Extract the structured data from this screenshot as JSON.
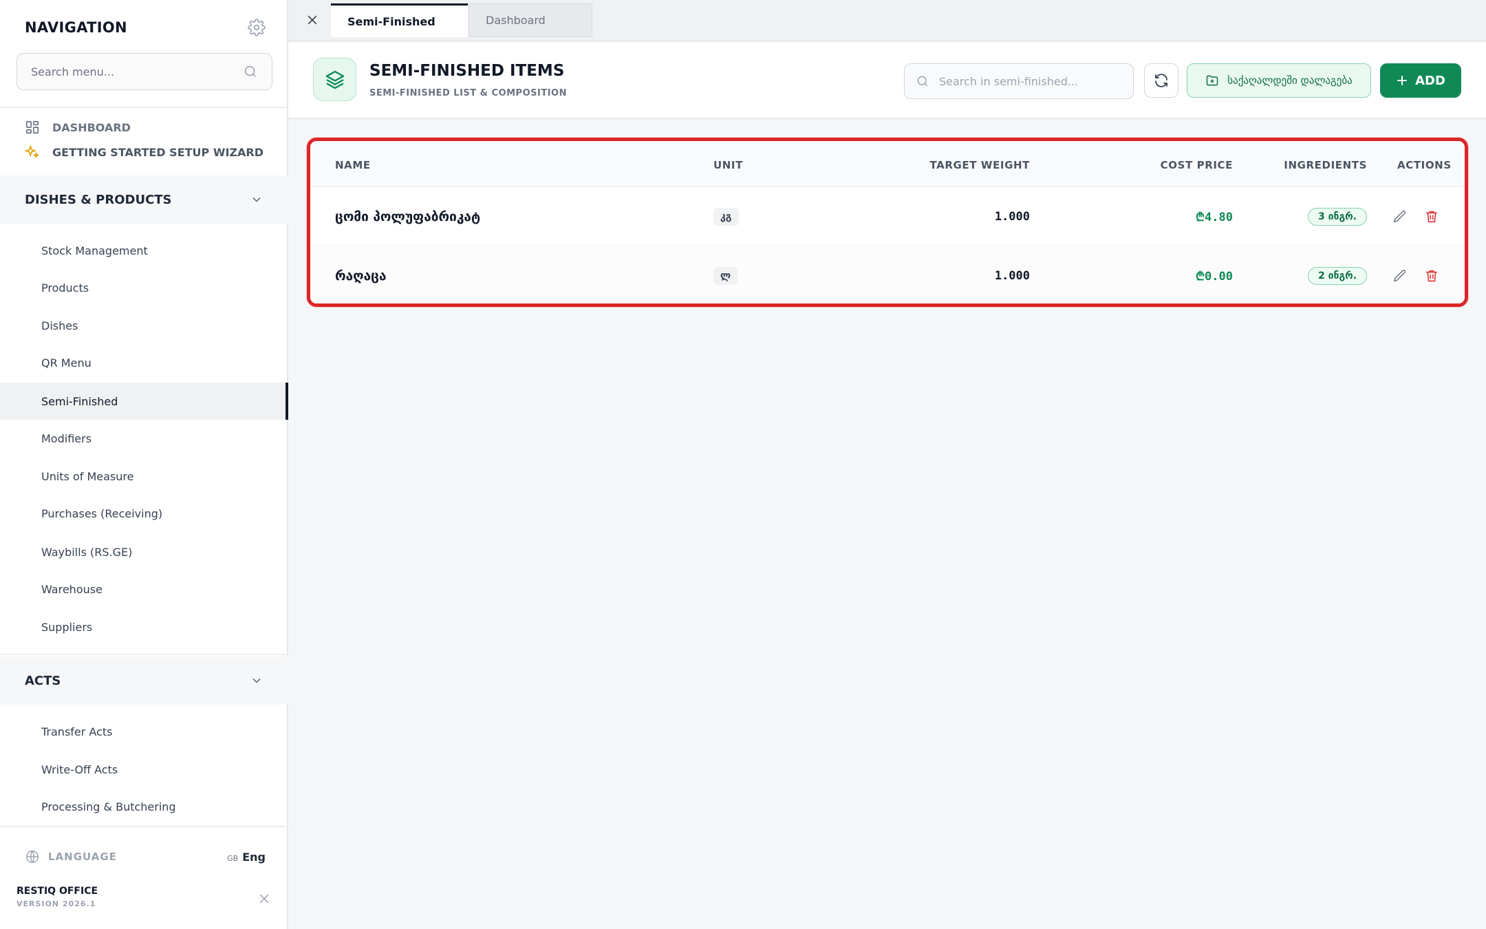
{
  "sidebar": {
    "title": "NAVIGATION",
    "search_placeholder": "Search menu...",
    "top_links": [
      {
        "label": "DASHBOARD",
        "icon": "grid-icon"
      },
      {
        "label": "GETTING STARTED SETUP WIZARD",
        "icon": "sparkle-icon"
      }
    ],
    "sections": [
      {
        "label": "DISHES & PRODUCTS",
        "items": [
          "Stock Management",
          "Products",
          "Dishes",
          "QR Menu",
          "Semi-Finished",
          "Modifiers",
          "Units of Measure",
          "Purchases (Receiving)",
          "Waybills (RS.GE)",
          "Warehouse",
          "Suppliers"
        ]
      },
      {
        "label": "ACTS",
        "items": [
          "Transfer Acts",
          "Write-Off Acts",
          "Processing & Butchering"
        ]
      }
    ],
    "active_item": "Semi-Finished",
    "language_label": "LANGUAGE",
    "language_code": "GB",
    "language_value": "Eng",
    "brand_name": "RESTIQ OFFICE",
    "brand_version": "VERSION 2026.1"
  },
  "tabs": [
    {
      "label": "Semi-Finished",
      "active": true
    },
    {
      "label": "Dashboard",
      "active": false
    }
  ],
  "header": {
    "title": "SEMI-FINISHED ITEMS",
    "subtitle": "SEMI-FINISHED LIST & COMPOSITION",
    "search_placeholder": "Search in semi-finished...",
    "folder_button": "საქაღალდეში დალაგება",
    "add_button": "ADD"
  },
  "table": {
    "columns": {
      "name": "NAME",
      "unit": "UNIT",
      "target_weight": "TARGET WEIGHT",
      "cost_price": "COST PRICE",
      "ingredients": "INGREDIENTS",
      "actions": "ACTIONS"
    },
    "rows": [
      {
        "name": "ცომი პოლუფაბრიკატ",
        "unit": "კგ",
        "target_weight": "1.000",
        "cost_price": "₾4.80",
        "ingredients": "3 ინგრ."
      },
      {
        "name": "რაღაცა",
        "unit": "ლ",
        "target_weight": "1.000",
        "cost_price": "₾0.00",
        "ingredients": "2 ინგრ."
      }
    ]
  },
  "colors": {
    "accent": "#0f8a57",
    "danger": "#dc2626",
    "highlight_border": "#dc2626"
  }
}
